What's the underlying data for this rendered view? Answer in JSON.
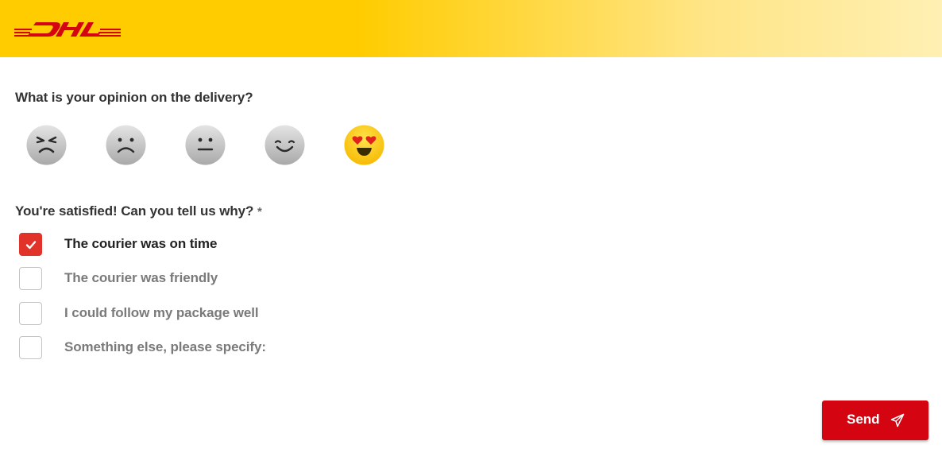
{
  "brand": {
    "logo_text": "DHL",
    "header_color": "#ffcc00",
    "brand_red": "#d40511"
  },
  "rating": {
    "question": "What is your opinion on the delivery?",
    "options": [
      {
        "icon": "angry-face-icon",
        "selected": false
      },
      {
        "icon": "sad-face-icon",
        "selected": false
      },
      {
        "icon": "neutral-face-icon",
        "selected": false
      },
      {
        "icon": "smiling-face-icon",
        "selected": false
      },
      {
        "icon": "heart-eyes-face-icon",
        "selected": true
      }
    ]
  },
  "reasons": {
    "question": "You're satisfied! Can you tell us why?",
    "required_marker": "*",
    "options": [
      {
        "label": "The courier was on time",
        "checked": true
      },
      {
        "label": "The courier was friendly",
        "checked": false
      },
      {
        "label": "I could follow my package well",
        "checked": false
      },
      {
        "label": "Something else, please specify:",
        "checked": false
      }
    ]
  },
  "actions": {
    "send_label": "Send",
    "send_icon": "paper-plane-icon"
  }
}
